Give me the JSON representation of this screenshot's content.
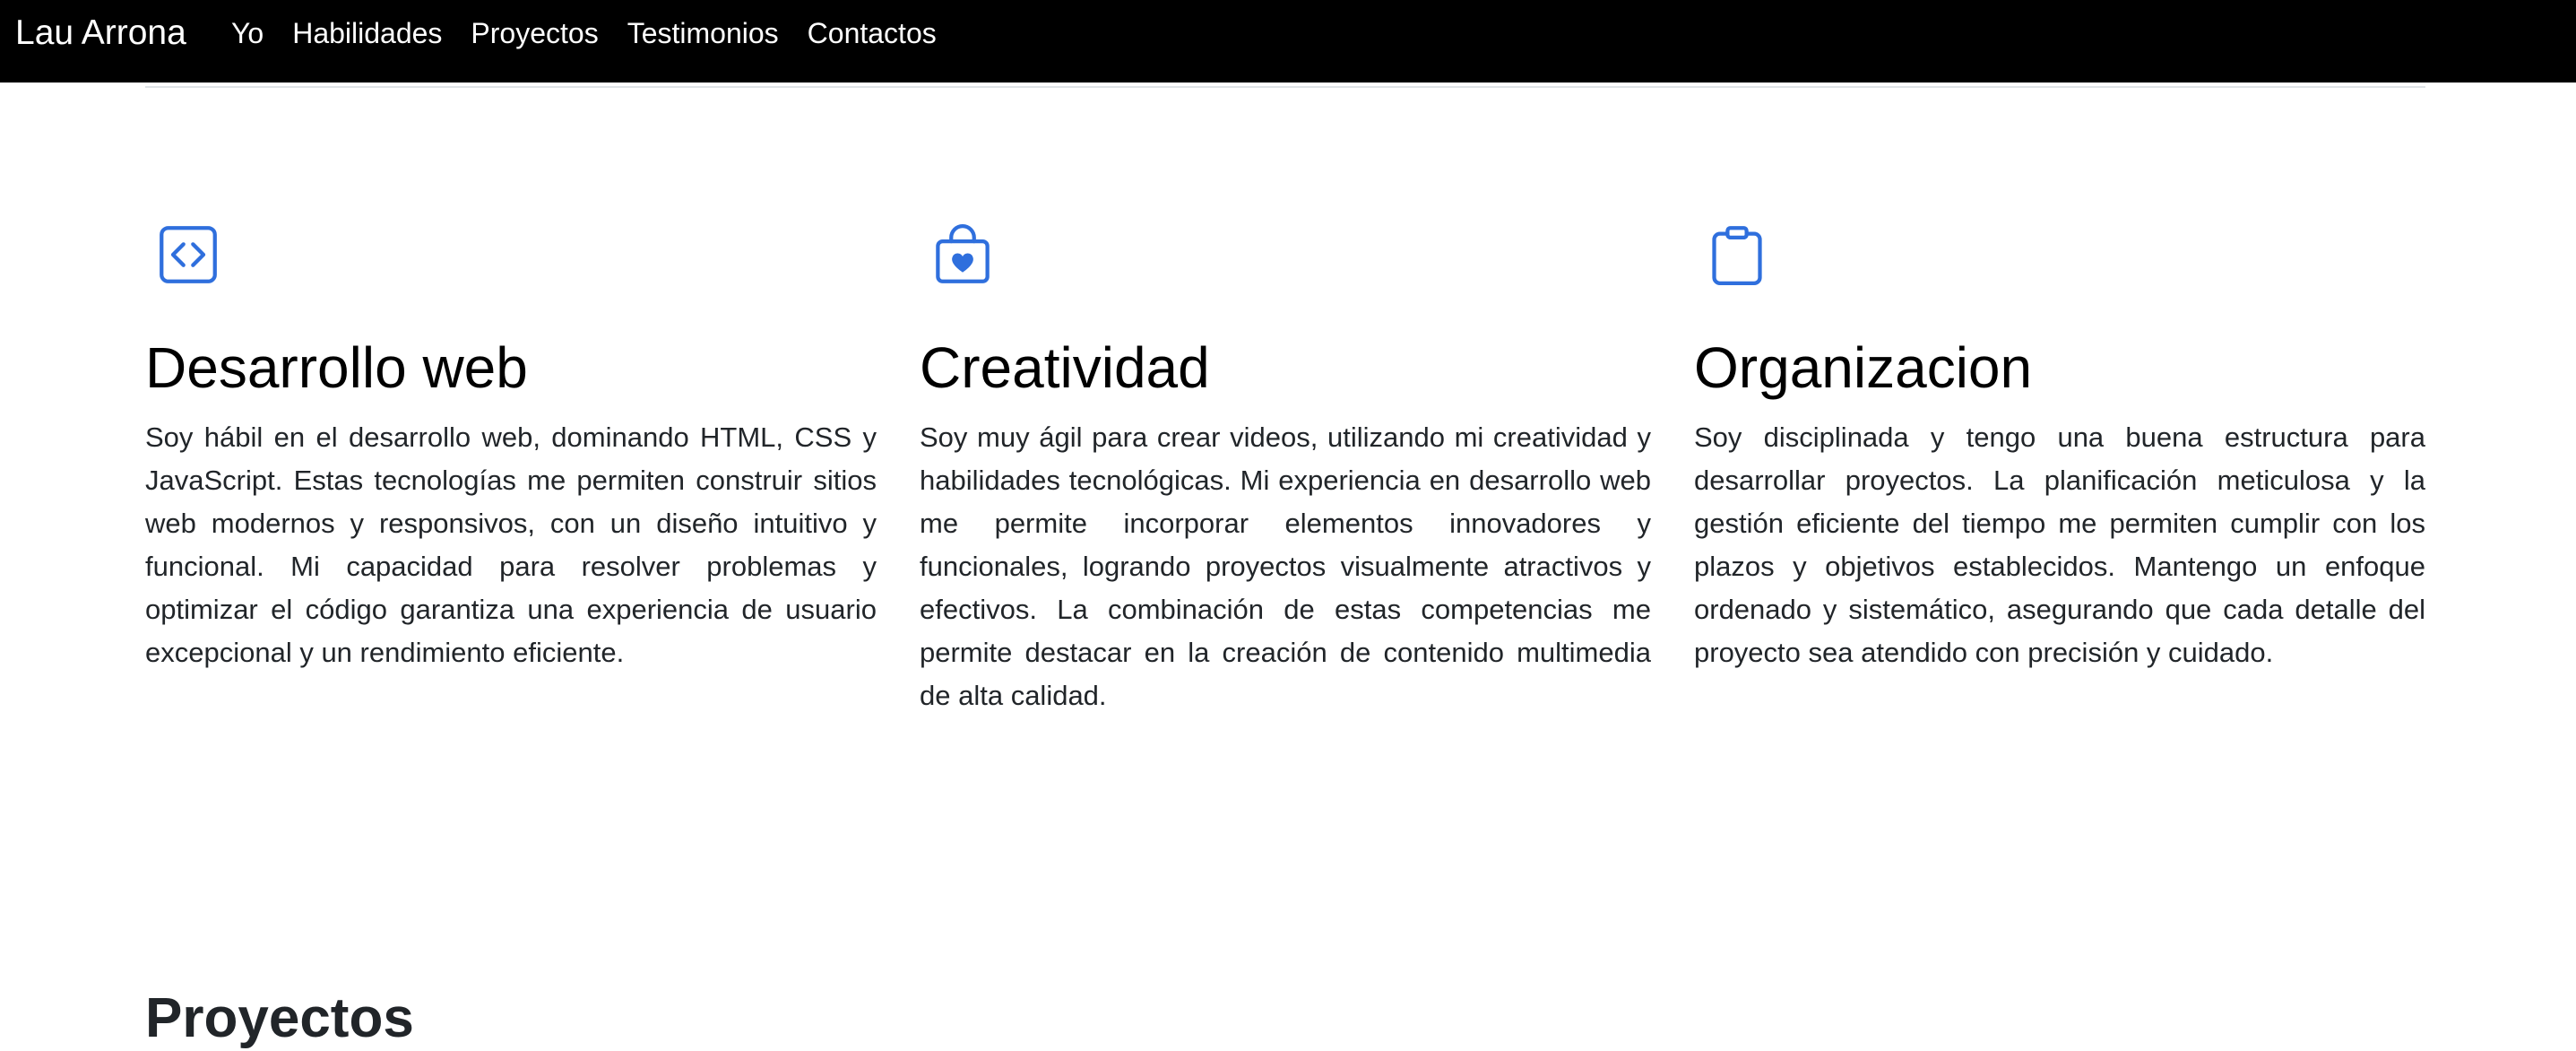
{
  "navbar": {
    "brand": "Lau Arrona",
    "links": [
      "Yo",
      "Habilidades",
      "Proyectos",
      "Testimonios",
      "Contactos"
    ]
  },
  "colors": {
    "navbar_bg": "#000000",
    "icon_accent": "#2f6fdd"
  },
  "features": [
    {
      "icon": "code-square-icon",
      "title": "Desarrollo web",
      "text": "Soy hábil en el desarrollo web, dominando HTML, CSS y JavaScript. Estas tecnologías me permiten construir sitios web modernos y responsivos, con un diseño intuitivo y funcional. Mi capacidad para resolver problemas y optimizar el código garantiza una experiencia de usuario excepcional y un rendimiento eficiente."
    },
    {
      "icon": "bag-heart-icon",
      "title": "Creatividad",
      "text": "Soy muy ágil para crear videos, utilizando mi creatividad y habilidades tecnológicas. Mi experiencia en desarrollo web me permite incorporar elementos innovadores y funcionales, logrando proyectos visualmente atractivos y efectivos. La combinación de estas competencias me permite destacar en la creación de contenido multimedia de alta calidad."
    },
    {
      "icon": "clipboard-icon",
      "title": "Organizacion",
      "text": "Soy disciplinada y tengo una buena estructura para desarrollar proyectos. La planificación meticulosa y la gestión eficiente del tiempo me permiten cumplir con los plazos y objetivos establecidos. Mantengo un enfoque ordenado y sistemático, asegurando que cada detalle del proyecto sea atendido con precisión y cuidado."
    }
  ],
  "next_section": {
    "title": "Proyectos"
  }
}
